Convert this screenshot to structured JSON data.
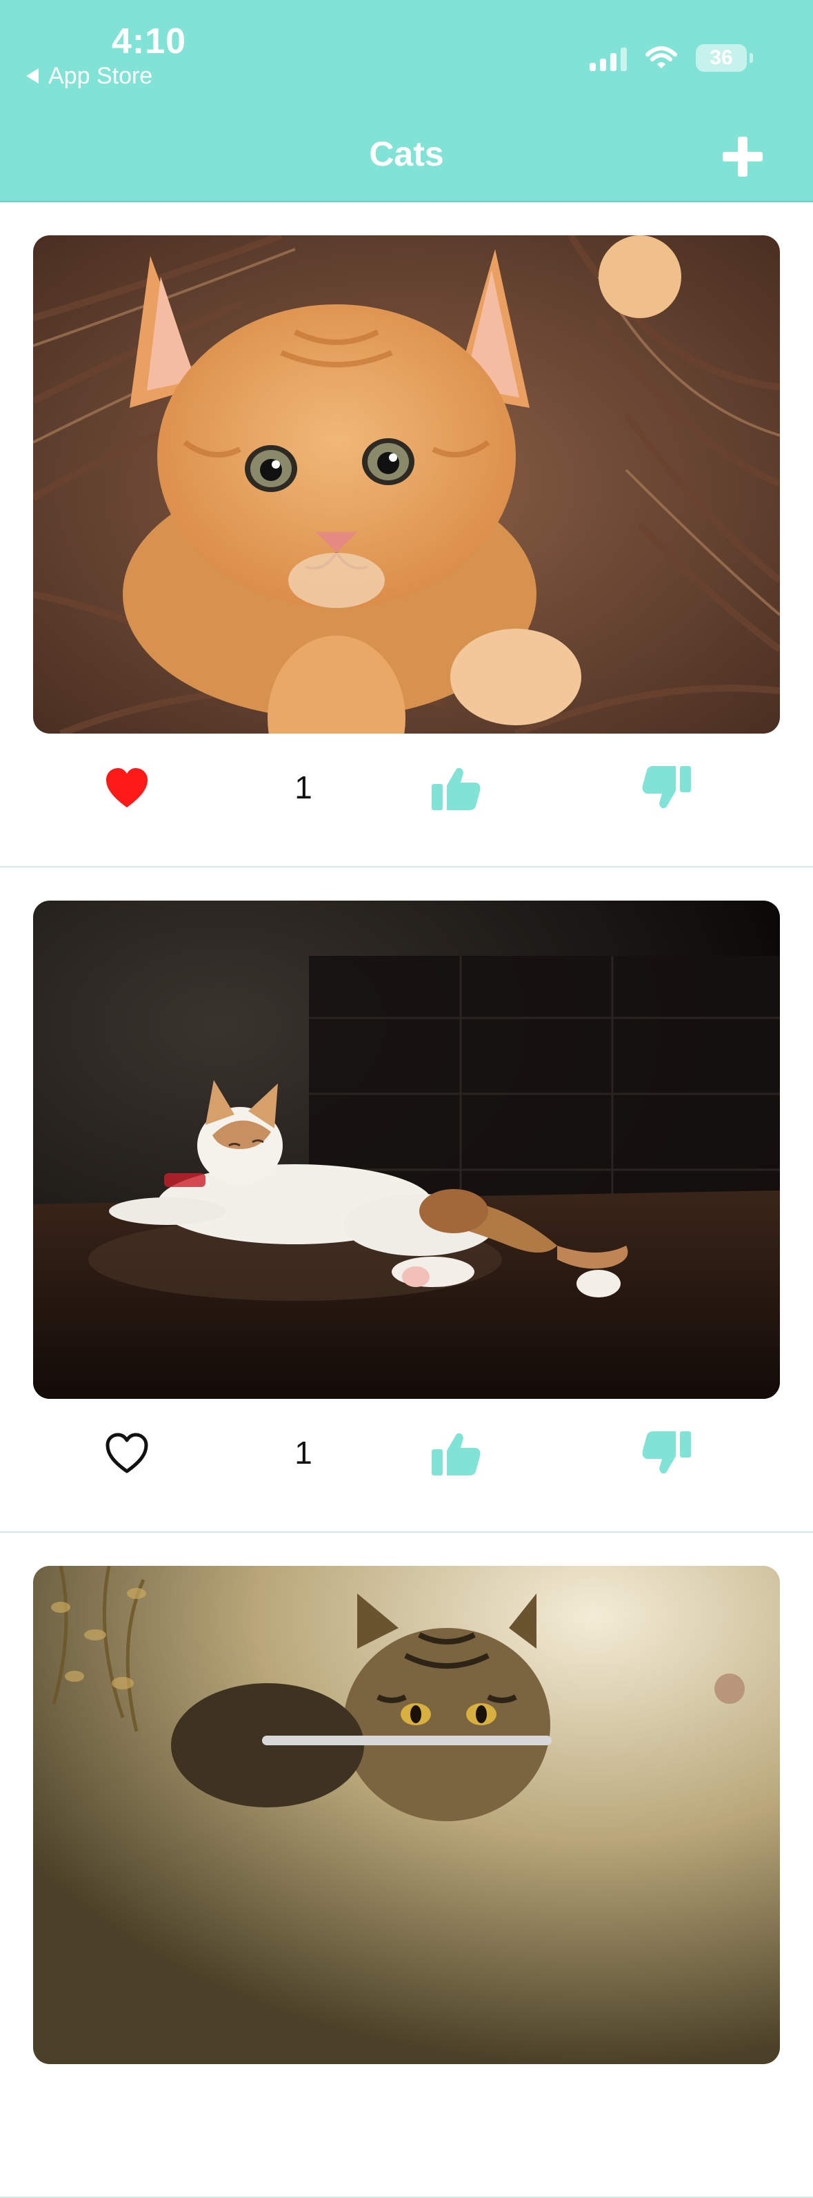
{
  "status_bar": {
    "time": "4:10",
    "back_label": "App Store",
    "battery": "36"
  },
  "nav": {
    "title": "Cats",
    "add_icon": "plus-icon"
  },
  "colors": {
    "accent": "#80e3d5",
    "liked": "#ff1a1a",
    "text": "#111111",
    "divider": "#cfe9e5"
  },
  "posts": [
    {
      "photo": "orange kitten in wicker basket",
      "liked": true,
      "count": "1"
    },
    {
      "photo": "white and orange cat lying on dark table",
      "liked": false,
      "count": "1"
    },
    {
      "photo": "tabby cat in sunlight",
      "liked": false,
      "count": ""
    }
  ]
}
